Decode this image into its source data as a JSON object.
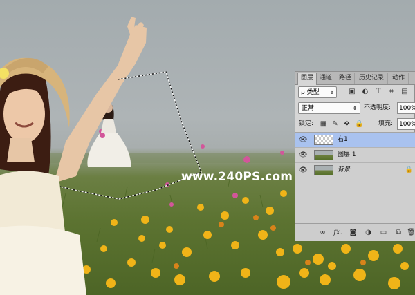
{
  "photo": {
    "watermark": "www.240PS.com"
  },
  "panel": {
    "tabs": [
      {
        "label": "图层"
      },
      {
        "label": "通道"
      },
      {
        "label": "路径"
      },
      {
        "label": "历史记录"
      },
      {
        "label": "动作"
      }
    ],
    "filter_label": "ρ 类型",
    "filter_icons": [
      "image-filter-icon",
      "adjustment-filter-icon",
      "type-filter-icon",
      "shape-filter-icon",
      "smart-object-filter-icon"
    ],
    "blend_mode": "正常",
    "opacity_label": "不透明度:",
    "opacity_value": "100%",
    "lock_label": "锁定:",
    "lock_icons": [
      "lock-transparency-icon",
      "lock-pixels-icon",
      "lock-position-icon",
      "lock-all-icon"
    ],
    "fill_label": "填充:",
    "fill_value": "100%",
    "layers": [
      {
        "name": "右1",
        "selected": true,
        "italic": false,
        "locked": false
      },
      {
        "name": "图层 1",
        "selected": false,
        "italic": false,
        "locked": false
      },
      {
        "name": "背景",
        "selected": false,
        "italic": true,
        "locked": true
      }
    ],
    "bottom_icons": [
      "link-layers-icon",
      "layer-style-fx-icon",
      "add-mask-icon",
      "adjustment-layer-icon",
      "new-group-icon",
      "new-layer-icon",
      "delete-layer-icon"
    ],
    "fx_label": "fx."
  }
}
